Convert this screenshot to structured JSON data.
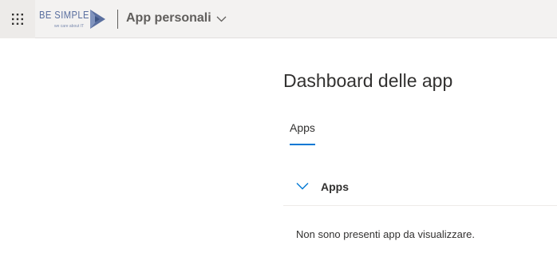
{
  "header": {
    "logo": {
      "text": "BE SIMPLE",
      "tagline": "we care about IT"
    },
    "app_switcher_label": "App personali",
    "icons": {
      "waffle": "app-launcher-icon",
      "chevron": "chevron-down-icon",
      "logo_mark": "play-triangle-icon"
    },
    "colors": {
      "bar_bg": "#f3f2f1",
      "logo": "#5a6f9f"
    }
  },
  "main": {
    "title": "Dashboard delle app",
    "tabs": [
      {
        "label": "Apps",
        "selected": true
      }
    ],
    "group": {
      "label": "Apps",
      "expanded": true
    },
    "empty_message": "Non sono presenti app da visualizzare.",
    "colors": {
      "accent": "#0078d4"
    }
  }
}
